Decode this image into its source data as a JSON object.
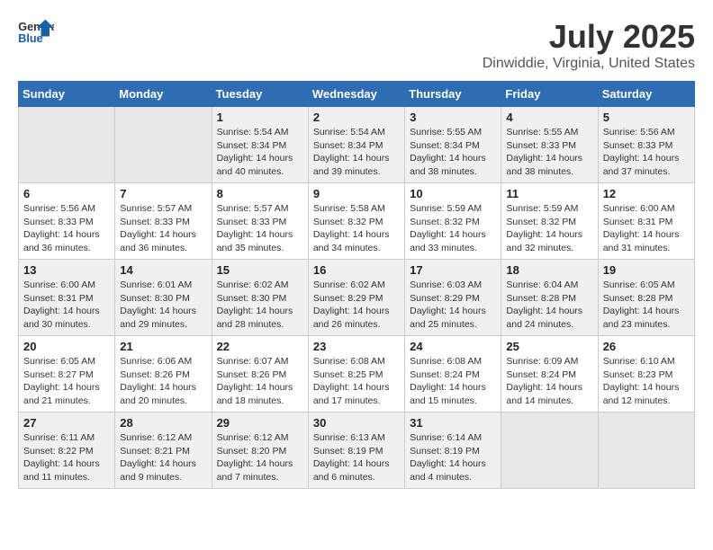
{
  "header": {
    "logo_general": "General",
    "logo_blue": "Blue",
    "month_year": "July 2025",
    "location": "Dinwiddie, Virginia, United States"
  },
  "days_of_week": [
    "Sunday",
    "Monday",
    "Tuesday",
    "Wednesday",
    "Thursday",
    "Friday",
    "Saturday"
  ],
  "weeks": [
    [
      {
        "day": "",
        "empty": true
      },
      {
        "day": "",
        "empty": true
      },
      {
        "day": "1",
        "sunrise": "5:54 AM",
        "sunset": "8:34 PM",
        "daylight": "14 hours and 40 minutes."
      },
      {
        "day": "2",
        "sunrise": "5:54 AM",
        "sunset": "8:34 PM",
        "daylight": "14 hours and 39 minutes."
      },
      {
        "day": "3",
        "sunrise": "5:55 AM",
        "sunset": "8:34 PM",
        "daylight": "14 hours and 38 minutes."
      },
      {
        "day": "4",
        "sunrise": "5:55 AM",
        "sunset": "8:33 PM",
        "daylight": "14 hours and 38 minutes."
      },
      {
        "day": "5",
        "sunrise": "5:56 AM",
        "sunset": "8:33 PM",
        "daylight": "14 hours and 37 minutes."
      }
    ],
    [
      {
        "day": "6",
        "sunrise": "5:56 AM",
        "sunset": "8:33 PM",
        "daylight": "14 hours and 36 minutes."
      },
      {
        "day": "7",
        "sunrise": "5:57 AM",
        "sunset": "8:33 PM",
        "daylight": "14 hours and 36 minutes."
      },
      {
        "day": "8",
        "sunrise": "5:57 AM",
        "sunset": "8:33 PM",
        "daylight": "14 hours and 35 minutes."
      },
      {
        "day": "9",
        "sunrise": "5:58 AM",
        "sunset": "8:32 PM",
        "daylight": "14 hours and 34 minutes."
      },
      {
        "day": "10",
        "sunrise": "5:59 AM",
        "sunset": "8:32 PM",
        "daylight": "14 hours and 33 minutes."
      },
      {
        "day": "11",
        "sunrise": "5:59 AM",
        "sunset": "8:32 PM",
        "daylight": "14 hours and 32 minutes."
      },
      {
        "day": "12",
        "sunrise": "6:00 AM",
        "sunset": "8:31 PM",
        "daylight": "14 hours and 31 minutes."
      }
    ],
    [
      {
        "day": "13",
        "sunrise": "6:00 AM",
        "sunset": "8:31 PM",
        "daylight": "14 hours and 30 minutes."
      },
      {
        "day": "14",
        "sunrise": "6:01 AM",
        "sunset": "8:30 PM",
        "daylight": "14 hours and 29 minutes."
      },
      {
        "day": "15",
        "sunrise": "6:02 AM",
        "sunset": "8:30 PM",
        "daylight": "14 hours and 28 minutes."
      },
      {
        "day": "16",
        "sunrise": "6:02 AM",
        "sunset": "8:29 PM",
        "daylight": "14 hours and 26 minutes."
      },
      {
        "day": "17",
        "sunrise": "6:03 AM",
        "sunset": "8:29 PM",
        "daylight": "14 hours and 25 minutes."
      },
      {
        "day": "18",
        "sunrise": "6:04 AM",
        "sunset": "8:28 PM",
        "daylight": "14 hours and 24 minutes."
      },
      {
        "day": "19",
        "sunrise": "6:05 AM",
        "sunset": "8:28 PM",
        "daylight": "14 hours and 23 minutes."
      }
    ],
    [
      {
        "day": "20",
        "sunrise": "6:05 AM",
        "sunset": "8:27 PM",
        "daylight": "14 hours and 21 minutes."
      },
      {
        "day": "21",
        "sunrise": "6:06 AM",
        "sunset": "8:26 PM",
        "daylight": "14 hours and 20 minutes."
      },
      {
        "day": "22",
        "sunrise": "6:07 AM",
        "sunset": "8:26 PM",
        "daylight": "14 hours and 18 minutes."
      },
      {
        "day": "23",
        "sunrise": "6:08 AM",
        "sunset": "8:25 PM",
        "daylight": "14 hours and 17 minutes."
      },
      {
        "day": "24",
        "sunrise": "6:08 AM",
        "sunset": "8:24 PM",
        "daylight": "14 hours and 15 minutes."
      },
      {
        "day": "25",
        "sunrise": "6:09 AM",
        "sunset": "8:24 PM",
        "daylight": "14 hours and 14 minutes."
      },
      {
        "day": "26",
        "sunrise": "6:10 AM",
        "sunset": "8:23 PM",
        "daylight": "14 hours and 12 minutes."
      }
    ],
    [
      {
        "day": "27",
        "sunrise": "6:11 AM",
        "sunset": "8:22 PM",
        "daylight": "14 hours and 11 minutes."
      },
      {
        "day": "28",
        "sunrise": "6:12 AM",
        "sunset": "8:21 PM",
        "daylight": "14 hours and 9 minutes."
      },
      {
        "day": "29",
        "sunrise": "6:12 AM",
        "sunset": "8:20 PM",
        "daylight": "14 hours and 7 minutes."
      },
      {
        "day": "30",
        "sunrise": "6:13 AM",
        "sunset": "8:19 PM",
        "daylight": "14 hours and 6 minutes."
      },
      {
        "day": "31",
        "sunrise": "6:14 AM",
        "sunset": "8:19 PM",
        "daylight": "14 hours and 4 minutes."
      },
      {
        "day": "",
        "empty": true
      },
      {
        "day": "",
        "empty": true
      }
    ]
  ],
  "labels": {
    "sunrise_prefix": "Sunrise: ",
    "sunset_prefix": "Sunset: ",
    "daylight_prefix": "Daylight: "
  }
}
